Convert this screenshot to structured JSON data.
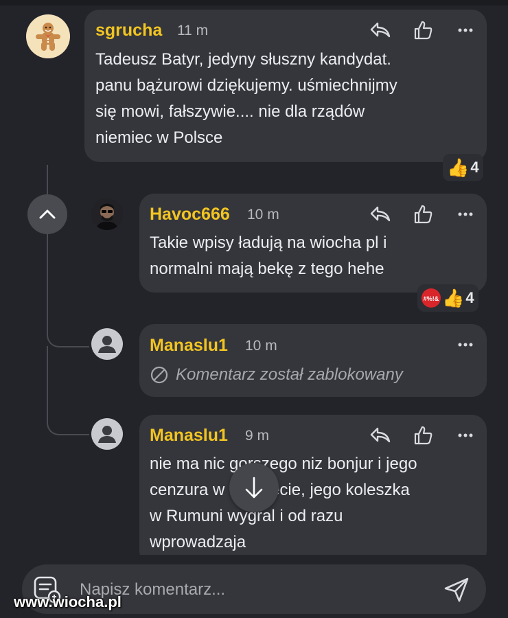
{
  "comments": [
    {
      "username": "sgrucha",
      "time": "11 m",
      "text": "Tadeusz Batyr, jedyny słuszny kandydat.\npanu bążurowi dziękujemy. uśmiechnijmy\nsię mowi, fałszywie.... nie dla rządów\nniemiec w Polsce",
      "reactions": {
        "count": "4",
        "icons": [
          "thumbs-up-emoji"
        ]
      }
    },
    {
      "username": "Havoc666",
      "time": "10 m",
      "text": "Takie wpisy ładują na wiocha pl i\nnormalni mają bekę z tego hehe",
      "reactions": {
        "count": "4",
        "icons": [
          "angry-swearing-emoji",
          "thumbs-up-emoji"
        ]
      }
    },
    {
      "username": "Manaslu1",
      "time": "10 m",
      "blocked_text": "Komentarz został zablokowany"
    },
    {
      "username": "Manaslu1",
      "time": "9 m",
      "text": "nie ma nic gorszego niz bonjur i jego\ncenzura w internecie, jego koleszka\nw Rumuni wygral i od razu\nwprowadzaja"
    }
  ],
  "input": {
    "placeholder": "Napisz komentarz..."
  },
  "watermark": "www.wiocha.pl",
  "colors": {
    "username": "#f2c521",
    "bubble": "#35363c",
    "background": "#232429"
  }
}
